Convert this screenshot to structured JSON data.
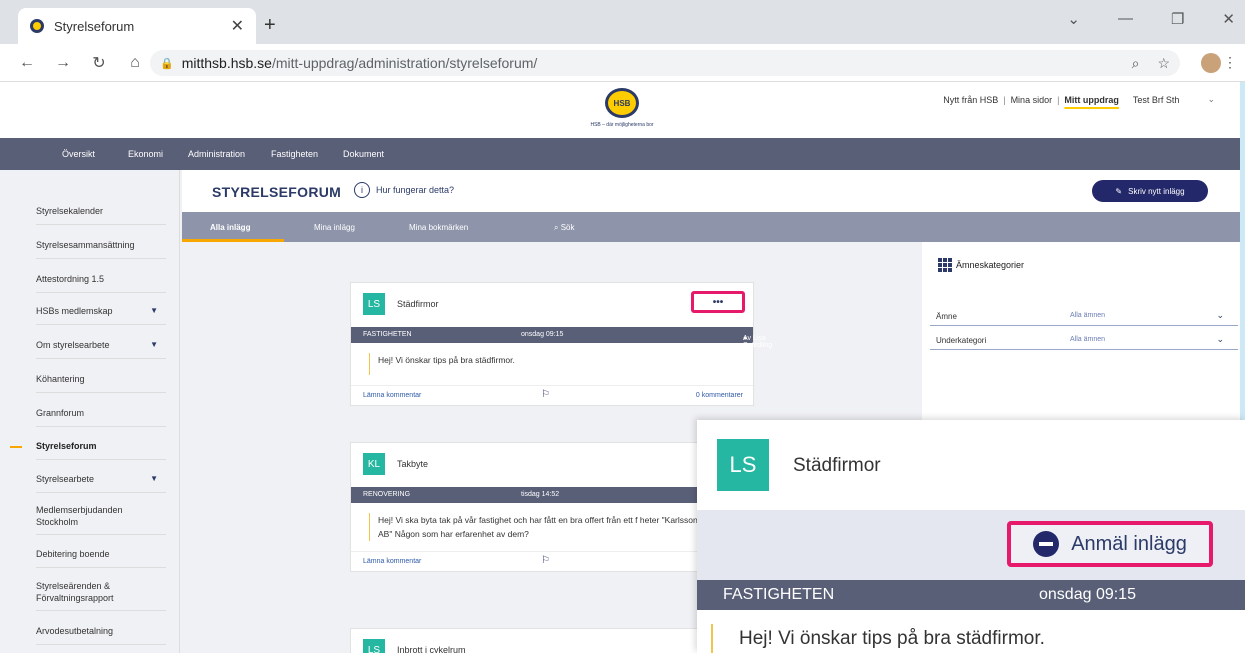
{
  "browser": {
    "tab_title": "Styrelseforum",
    "url_host": "mitthsb.hsb.se",
    "url_path": "/mitt-uppdrag/administration/styrelseforum/"
  },
  "header": {
    "logo_text": "HSB",
    "logo_tagline": "HSB – där möjligheterna bor",
    "links": [
      "Nytt från HSB",
      "Mina sidor",
      "Mitt uppdrag"
    ],
    "org": "Test Brf Sth"
  },
  "mainnav": [
    "Översikt",
    "Ekonomi",
    "Administration",
    "Fastigheten",
    "Dokument"
  ],
  "sidebar": [
    {
      "label": "Styrelsekalender"
    },
    {
      "label": "Styrelsesammansättning"
    },
    {
      "label": "Attestordning 1.5"
    },
    {
      "label": "HSBs medlemskap"
    },
    {
      "label": "Om styrelsearbete"
    },
    {
      "label": "Köhantering"
    },
    {
      "label": "Grannforum"
    },
    {
      "label": "Styrelseforum"
    },
    {
      "label": "Styrelsearbete"
    },
    {
      "label": "Medlemserbjudanden Stockholm"
    },
    {
      "label": "Debitering boende"
    },
    {
      "label": "Styrelseärenden & Förvaltningsrapport"
    },
    {
      "label": "Arvodesutbetalning"
    }
  ],
  "forum": {
    "title": "STYRELSEFORUM",
    "help": "Hur fungerar detta?",
    "write_button": "Skriv nytt inlägg",
    "tabs": [
      "Alla inlägg",
      "Mina inlägg",
      "Mina bokmärken",
      "Sök"
    ]
  },
  "categories": {
    "title": "Ämneskategorier",
    "rows": [
      {
        "label": "Ämne",
        "value": "Alla ämnen"
      },
      {
        "label": "Underkategori",
        "value": "Alla ämnen"
      }
    ]
  },
  "posts": [
    {
      "initials": "LS",
      "title": "Städfirmor",
      "category": "FASTIGHETEN",
      "time": "onsdag 09:15",
      "author": "Av Lisa Svärdling",
      "body": "Hej! Vi önskar tips på bra städfirmor.",
      "comment_link": "Lämna kommentar",
      "comments": "0 kommentarer"
    },
    {
      "initials": "KL",
      "title": "Takbyte",
      "category": "RENOVERING",
      "time": "tisdag 14:52",
      "author": "Av",
      "body": "Hej! Vi ska byta tak på vår fastighet och har fått en bra offert från ett f heter \"Karlsson på Taket AB\" Någon som har erfarenhet av dem?",
      "comment_link": "Lämna kommentar",
      "comments": ""
    },
    {
      "initials": "LS",
      "title": "Inbrott i cykelrum"
    }
  ],
  "zoom": {
    "initials": "LS",
    "title": "Städfirmor",
    "report": "Anmäl inlägg",
    "category": "FASTIGHETEN",
    "time": "onsdag 09:15",
    "body": "Hej! Vi önskar tips på bra städfirmor."
  },
  "colors": {
    "navy": "#2b3a67",
    "nav_bg": "#5a5f78",
    "teal": "#25b7a1",
    "highlight": "#e6196b",
    "accent": "#f7a700"
  }
}
